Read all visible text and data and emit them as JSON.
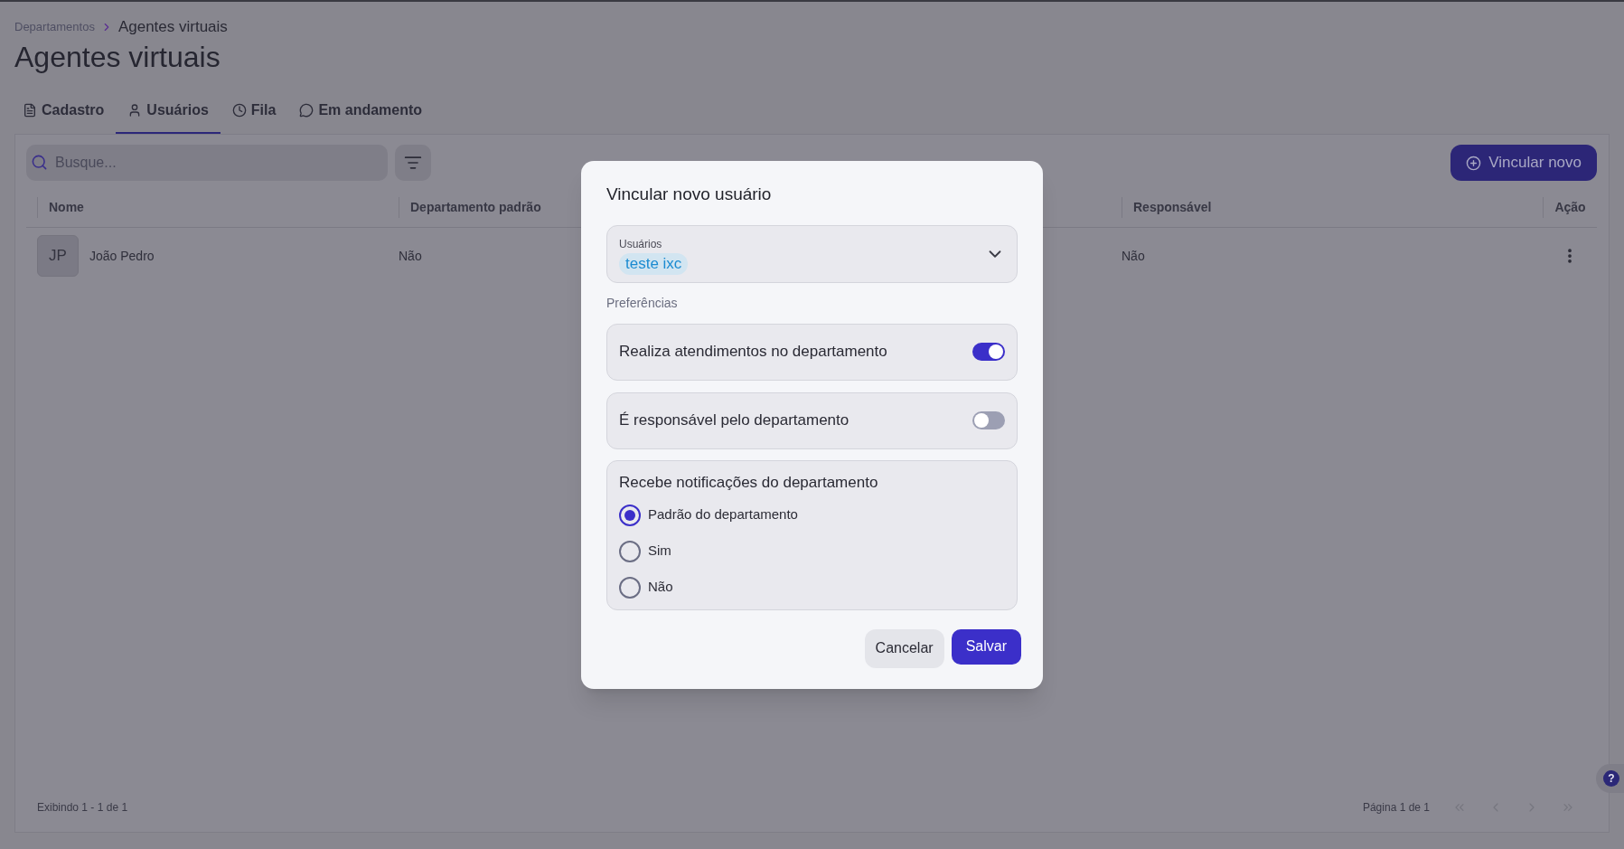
{
  "breadcrumb": [
    {
      "label": "Departamentos"
    },
    {
      "label": "Agentes virtuais"
    }
  ],
  "page_title": "Agentes virtuais",
  "tabs": [
    {
      "label": "Cadastro",
      "selected": false
    },
    {
      "label": "Usuários",
      "selected": true
    },
    {
      "label": "Fila",
      "selected": false
    },
    {
      "label": "Em andamento",
      "selected": false
    }
  ],
  "toolbar": {
    "search": {
      "placeholder": "Busque..."
    },
    "add_button": "Vincular novo"
  },
  "table": {
    "columns": [
      "Nome",
      "Departamento padrão",
      "Responsável",
      "Ação"
    ],
    "rows": [
      {
        "initials": "JP",
        "name": "João Pedro",
        "default_department": "Não",
        "responsible": "Não"
      }
    ]
  },
  "footer": {
    "summary": "Exibindo 1 - 1 de 1",
    "page": "Página 1 de 1",
    "page_buttons": [
      {
        "disabled": true
      },
      {
        "disabled": true
      },
      {
        "disabled": true
      },
      {
        "disabled": true
      }
    ]
  },
  "help_button": "?",
  "dialog": {
    "title": "Vincular novo usuário",
    "users_field": {
      "label": "Usuários",
      "chips": [
        "teste ixc"
      ]
    },
    "preferences_label": "Preferências",
    "toggles": [
      {
        "label": "Realiza atendimentos no departamento",
        "on": true
      },
      {
        "label": "É responsável pelo departamento",
        "on": false
      }
    ],
    "notifications": {
      "title": "Recebe notificações do departamento",
      "options": [
        {
          "label": "Padrão do departamento",
          "selected": true
        },
        {
          "label": "Sim",
          "selected": false
        },
        {
          "label": "Não",
          "selected": false
        }
      ]
    },
    "cancel_button": "Cancelar",
    "save_button": "Salvar"
  }
}
